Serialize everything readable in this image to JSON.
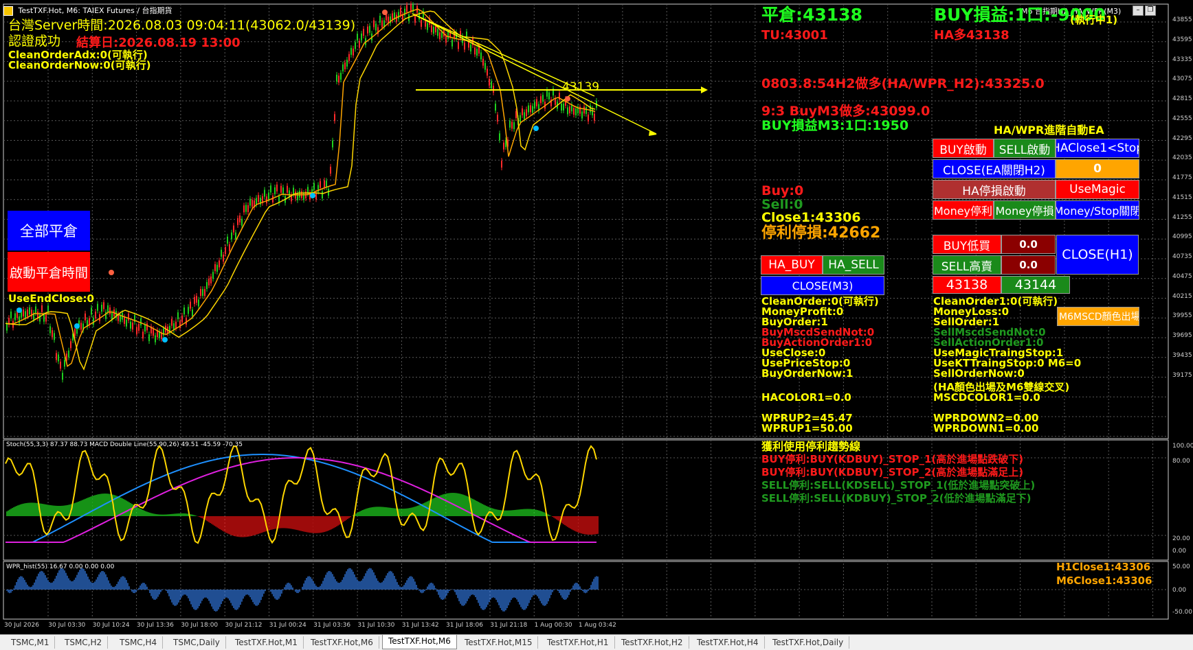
{
  "window": {
    "title": "TestTXF.Hot, M6:  TAIEX Futures / 台指期貨",
    "title_right": "M6 台指期H2_HA_WPR(M3)"
  },
  "header_left": {
    "server_time": "台灣Server時間:2026.08.03 09:04:11(43062.0/43139)",
    "auth": "認證成功",
    "settle": "結算日:2026.08.19 13:00",
    "clean_adx": "CleanOrderAdx:0(可執行)",
    "clean_now": "CleanOrderNow:0(可執行)"
  },
  "left_buttons": {
    "close_all": "全部平倉",
    "start_close_time": "啟動平倉時間",
    "use_end_close": "UseEndClose:0"
  },
  "chart_labels": {
    "price_line_label": "43139"
  },
  "status": {
    "position": "平倉:43138",
    "tu": "TU:43001",
    "buy_pl": "BUY損益:1口:-9000",
    "running": "(執行中1)",
    "ha_long": "HA多43138",
    "h2_long": "0803.8:54H2做多(HA/WPR_H2):43325.0",
    "m3_buy": "9:3 BuyM3做多:43099.0",
    "m3_pl": "BUY損益M3:1口:1950",
    "buy_count": "Buy:0",
    "sell_count": "Sell:0",
    "close1": "Close1:43306",
    "stop": "停利停損:42662"
  },
  "panel_right": {
    "title": "HA/WPR進階自動EA",
    "buy_start": "BUY啟動",
    "sell_start": "SELL啟動",
    "haclose": "HAClose1<Stop",
    "close_ea": "CLOSE(EA關閉H2)",
    "zero": "0",
    "ha_stop": "HA停損啟動",
    "use_magic": "UseMagic",
    "money_tp": "Money停利",
    "money_sl": "Money停損",
    "money_stop_close": "Money/Stop關閉",
    "buy_low": "BUY低買",
    "buy_low_val": "0.0",
    "sell_high": "SELL高賣",
    "sell_high_val": "0.0",
    "close_h1": "CLOSE(H1)",
    "price1": "43138",
    "price2": "43144",
    "m6_color": "M6MSCD顏色出場"
  },
  "panel_mid": {
    "ha_buy": "HA_BUY",
    "ha_sell": "HA_SELL",
    "close_m3": "CLOSE(M3)"
  },
  "info_left": [
    {
      "t": "CleanOrder:0(可執行)",
      "c": "#ffff00"
    },
    {
      "t": "MoneyProfit:0",
      "c": "#ffff00"
    },
    {
      "t": "BuyOrder:1",
      "c": "#ffff00"
    },
    {
      "t": "BuyMscdSendNot:0",
      "c": "#ff1a1a"
    },
    {
      "t": "BuyActionOrder1:0",
      "c": "#ff1a1a"
    },
    {
      "t": "UseClose:0",
      "c": "#ffff00"
    },
    {
      "t": "UsePriceStop:0",
      "c": "#ffff00"
    },
    {
      "t": "BuyOrderNow:1",
      "c": "#ffff00"
    }
  ],
  "info_right": [
    {
      "t": "CleanOrder1:0(可執行)",
      "c": "#ffff00"
    },
    {
      "t": "MoneyLoss:0",
      "c": "#ffff00"
    },
    {
      "t": "SellOrder:1",
      "c": "#ffff00"
    },
    {
      "t": "SellMscdSendNot:0",
      "c": "#1f9a1f"
    },
    {
      "t": "SellActionOrder1:0",
      "c": "#1f9a1f"
    },
    {
      "t": "UseMagicTraingStop:1",
      "c": "#ffff00"
    },
    {
      "t": "UseKTTraingStop:0  M6=0",
      "c": "#ffff00"
    },
    {
      "t": "SellOrderNow:0",
      "c": "#ffff00"
    }
  ],
  "ha_note": "(HA顏色出場及M6雙線交叉)",
  "hacolor": "HACOLOR1=0.0",
  "mscdcolor": "MSCDCOLOR1=0.0",
  "wprup2": "WPRUP2=45.47",
  "wprup1": "WPRUP1=50.00",
  "wprdown2": "WPRDOWN2=0.00",
  "wprdown1": "WPRDOWN1=0.00",
  "subwin1": {
    "label": "Stoch(55,3,3) 87.37 88.73 MACD Double Line(55,90,26) 49.51 -45.59 -70.35",
    "notes": [
      {
        "t": "獲利使用停利趨勢線",
        "c": "#ffff00"
      },
      {
        "t": "BUY停利:BUY(KDBUY)_STOP_1(高於進場點跌破下)",
        "c": "#ff1a1a"
      },
      {
        "t": "BUY停利:BUY(KDBUY)_STOP_2(高於進場點滿足上)",
        "c": "#ff1a1a"
      },
      {
        "t": "SELL停利:SELL(KDSELL)_STOP_1(低於進場點突破上)",
        "c": "#1f9a1f"
      },
      {
        "t": "SELL停利:SELL(KDBUY)_STOP_2(低於進場點滿足下)",
        "c": "#1f9a1f"
      }
    ],
    "axis": [
      "100.00",
      "80.00",
      "20.00",
      "0.00"
    ]
  },
  "subwin2": {
    "label": "WPR_hist(55) 16.67 0.00 0.00 0.00",
    "h1close": "H1Close1:43306",
    "m6close": "M6Close1:43306",
    "axis": [
      "50.00",
      "0.00",
      "-50.00"
    ]
  },
  "price_axis": [
    "43855",
    "43595",
    "43335",
    "43075",
    "42815",
    "42555",
    "42295",
    "42035",
    "41775",
    "41515",
    "41255",
    "40995",
    "40735",
    "40475",
    "40215",
    "39955",
    "39695",
    "39435",
    "39175"
  ],
  "time_axis": [
    "30 Jul 2026",
    "30 Jul 03:30",
    "30 Jul 10:24",
    "30 Jul 13:36",
    "30 Jul 18:00",
    "30 Jul 21:12",
    "31 Jul 00:24",
    "31 Jul 03:36",
    "31 Jul 10:30",
    "31 Jul 13:42",
    "31 Jul 18:06",
    "31 Jul 21:18",
    "1 Aug 00:30",
    "1 Aug 03:42"
  ],
  "tabs": [
    "TSMC,M1",
    "TSMC,H2",
    "TSMC,H4",
    "TSMC,Daily",
    "TestTXF.Hot,M1",
    "TestTXF.Hot,M6",
    "TestTXF.Hot,M6",
    "TestTXF.Hot,M15",
    "TestTXF.Hot,H1",
    "TestTXF.Hot,H2",
    "TestTXF.Hot,H4",
    "TestTXF.Hot,Daily"
  ],
  "active_tab": 6,
  "colors": {
    "yellow": "#ffff00",
    "red": "#ff1a1a",
    "green": "#1f9a1f",
    "orange": "#ffa500",
    "blue_btn": "#0000ff",
    "red_btn": "#ff0000",
    "green_btn": "#1a8a1a"
  }
}
